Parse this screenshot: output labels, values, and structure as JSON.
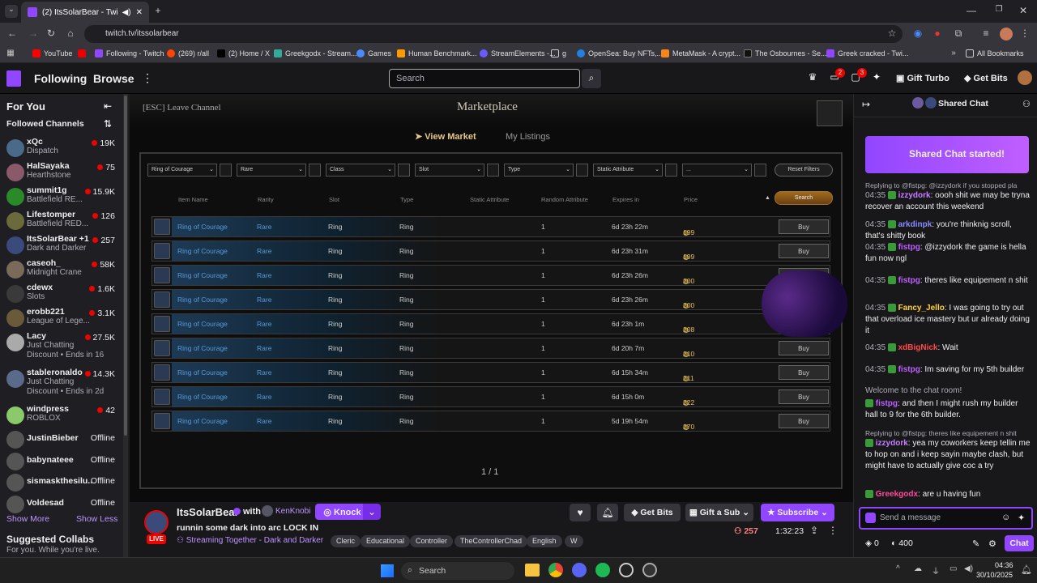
{
  "browser": {
    "tab_title": "(2) ItsSolarBear - Twitch",
    "url": "twitch.tv/itssolarbear",
    "bookmarks": [
      "YouTube",
      "Following - Twitch",
      "(269) r/all",
      "(2) Home / X",
      "Greekgodx - Stream...",
      "Games",
      "Human Benchmark...",
      "StreamElements -...",
      "g",
      "OpenSea: Buy NFTs,...",
      "MetaMask - A crypt...",
      "The Osbournes - Se...",
      "Greek cracked - Twi..."
    ],
    "all_bookmarks": "All Bookmarks"
  },
  "header": {
    "following": "Following",
    "browse": "Browse",
    "search_placeholder": "Search",
    "badge_inbox": "2",
    "badge_notifications": "3",
    "gift_turbo": "Gift Turbo",
    "get_bits": "Get Bits"
  },
  "sidebar": {
    "for_you": "For You",
    "followed": "Followed Channels",
    "channels": [
      {
        "name": "xQc",
        "game": "Dispatch",
        "viewers": "19K",
        "color": "#4a6a8a"
      },
      {
        "name": "HalSayaka",
        "game": "Hearthstone",
        "viewers": "75",
        "color": "#8a5a6a"
      },
      {
        "name": "summit1g",
        "game": "Battlefield RE...",
        "viewers": "15.9K",
        "color": "#2a8a2a"
      },
      {
        "name": "Lifestomper",
        "game": "Battlefield RED...",
        "viewers": "126",
        "color": "#6a6a3a"
      },
      {
        "name": "ItsSolarBear +1",
        "game": "Dark and Darker",
        "viewers": "257",
        "color": "#3a4a7a"
      },
      {
        "name": "caseoh_",
        "game": "Midnight Crane",
        "viewers": "58K",
        "color": "#7a6a5a"
      },
      {
        "name": "cdewx",
        "game": "Slots",
        "viewers": "1.6K",
        "color": "#3a3a3a"
      },
      {
        "name": "erobb221",
        "game": "League of Lege...",
        "viewers": "3.1K",
        "color": "#6a5a3a"
      },
      {
        "name": "Lacy",
        "game": "Just Chatting",
        "viewers": "27.5K",
        "color": "#aaaaaa",
        "discount": "Discount • Ends in 16"
      },
      {
        "name": "stableronaldo",
        "game": "Just Chatting",
        "viewers": "14.3K",
        "color": "#5a6a8a",
        "discount": "Discount • Ends in 2d"
      },
      {
        "name": "windpress",
        "game": "ROBLOX",
        "viewers": "42",
        "color": "#8aca6a"
      }
    ],
    "offline": [
      {
        "name": "JustinBieber",
        "status": "Offline"
      },
      {
        "name": "babynateee",
        "status": "Offline"
      },
      {
        "name": "sismaskthesilu...",
        "status": "Offline"
      },
      {
        "name": "Voldesad",
        "status": "Offline"
      }
    ],
    "show_more": "Show More",
    "show_less": "Show Less",
    "suggested": "Suggested Collabs",
    "suggested_sub": "For you. While you're live."
  },
  "game": {
    "leave": "[ESC] Leave Channel",
    "title": "Marketplace",
    "tab_view": "View Market",
    "tab_listings": "My Listings",
    "filters": [
      "Ring of Courage",
      "Rare",
      "Class",
      "Slot",
      "Type",
      "Static Attribute",
      "..."
    ],
    "reset": "Reset Filters",
    "columns": [
      "Item Name",
      "Rarity",
      "Slot",
      "Type",
      "Static Attribute",
      "Random Attribute",
      "Expires in",
      "Price"
    ],
    "search_btn": "Search",
    "rows": [
      {
        "name": "Ring of Courage",
        "rarity": "Rare",
        "slot": "Ring",
        "type": "Ring",
        "random": "1",
        "expires": "6d 23h 22m",
        "price": "199"
      },
      {
        "name": "Ring of Courage",
        "rarity": "Rare",
        "slot": "Ring",
        "type": "Ring",
        "random": "1",
        "expires": "6d 23h 31m",
        "price": "199"
      },
      {
        "name": "Ring of Courage",
        "rarity": "Rare",
        "slot": "Ring",
        "type": "Ring",
        "random": "1",
        "expires": "6d 23h 26m",
        "price": "200"
      },
      {
        "name": "Ring of Courage",
        "rarity": "Rare",
        "slot": "Ring",
        "type": "Ring",
        "random": "1",
        "expires": "6d 23h 26m",
        "price": "200"
      },
      {
        "name": "Ring of Courage",
        "rarity": "Rare",
        "slot": "Ring",
        "type": "Ring",
        "random": "1",
        "expires": "6d 23h 1m",
        "price": "208"
      },
      {
        "name": "Ring of Courage",
        "rarity": "Rare",
        "slot": "Ring",
        "type": "Ring",
        "random": "1",
        "expires": "6d 20h 7m",
        "price": "210"
      },
      {
        "name": "Ring of Courage",
        "rarity": "Rare",
        "slot": "Ring",
        "type": "Ring",
        "random": "1",
        "expires": "6d 15h 34m",
        "price": "211"
      },
      {
        "name": "Ring of Courage",
        "rarity": "Rare",
        "slot": "Ring",
        "type": "Ring",
        "random": "1",
        "expires": "6d 15h 0m",
        "price": "222"
      },
      {
        "name": "Ring of Courage",
        "rarity": "Rare",
        "slot": "Ring",
        "type": "Ring",
        "random": "1",
        "expires": "5d 19h 54m",
        "price": "270"
      }
    ],
    "buy": "Buy",
    "page": "1 / 1"
  },
  "stream": {
    "channel": "ItsSolarBear",
    "with": "with",
    "partner": "KenKnobi",
    "knock": "Knock",
    "live": "LIVE",
    "title": "runnin some dark into arc LOCK IN",
    "streaming_together": "Streaming Together",
    "game": "Dark and Darker",
    "tags": [
      "Cleric",
      "Educational",
      "Controller",
      "TheControllerChad",
      "English",
      "W"
    ],
    "get_bits": "Get Bits",
    "gift_sub": "Gift a Sub",
    "subscribe": "Subscribe",
    "viewers": "257",
    "uptime": "1:32:23"
  },
  "chat": {
    "title": "Shared Chat",
    "banner": "Shared Chat started!",
    "messages": [
      {
        "reply": "Replying to @fistpg: @izzydork if you stopped pla"
      },
      {
        "ts": "04:35",
        "user": "izzydork",
        "color": "#c77dff",
        "text": ": oooh shit we may be tryna recover an account this weekend"
      },
      {
        "ts": "04:35",
        "user": "arkdinpk",
        "color": "#8a8cff",
        "text": ": you're thinknig scroll, that's shitty book"
      },
      {
        "ts": "04:35",
        "user": "fistpg",
        "color": "#bf5fff",
        "text": ": @izzydork the game is hella fun now ngl"
      },
      {
        "ts": "04:35",
        "user": "fistpg",
        "color": "#bf5fff",
        "text": ": theres like equipement n shit"
      },
      {
        "ts": "04:35",
        "user": "Fancy_Jello",
        "color": "#ffd23c",
        "text": ": I was going to try out that overload ice mastery but ur already doing it"
      },
      {
        "ts": "04:35",
        "user": "xdBigNick",
        "color": "#ff4a4a",
        "text": ": Wait"
      },
      {
        "ts": "04:35",
        "user": "fistpg",
        "color": "#bf5fff",
        "text": ": Im saving for my 5th builder"
      },
      {
        "system": "Welcome to the chat room!"
      },
      {
        "user": "fistpg",
        "color": "#bf5fff",
        "text": ": and then I might rush my builder hall to 9 for the 6th builder."
      },
      {
        "reply": "Replying to @fistpg: theres like equipement n shit"
      },
      {
        "user": "izzydork",
        "color": "#c77dff",
        "text": ": yea my coworkers keep tellin me to hop on and i keep sayin maybe clash, but might have to actually give coc a try"
      },
      {
        "user": "Greekgodx",
        "color": "#ff4a9a",
        "text": ": are u having fun"
      }
    ],
    "input_placeholder": "Send a message",
    "points_a": "0",
    "points_b": "400",
    "chat_btn": "Chat"
  },
  "taskbar": {
    "search": "Search",
    "time": "04:36",
    "date": "30/10/2025"
  }
}
